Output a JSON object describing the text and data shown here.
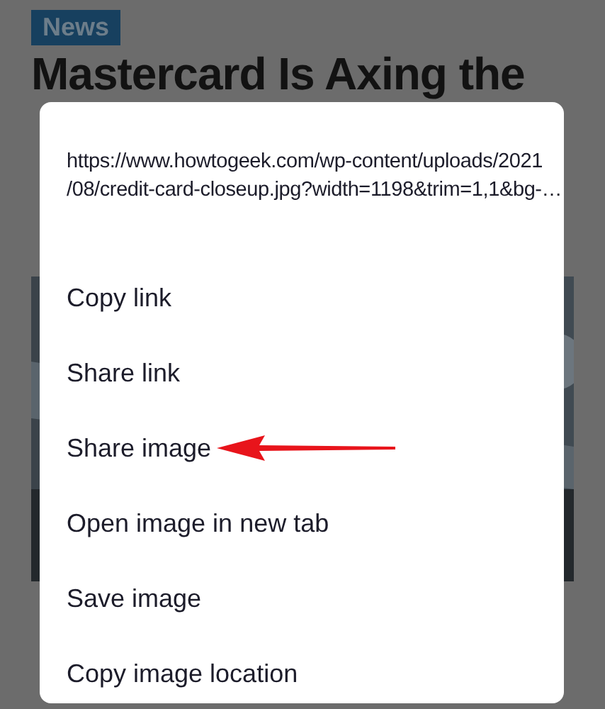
{
  "page": {
    "tag": "News",
    "headline": "Mastercard Is Axing the"
  },
  "dialog": {
    "url_lines": [
      "https://www.howtogeek.com/wp-content/uploads/2021",
      "/08/credit-card-closeup.jpg?width=1198&trim=1,1&bg-…"
    ],
    "items": [
      {
        "label": "Copy link",
        "highlighted": false
      },
      {
        "label": "Share link",
        "highlighted": false
      },
      {
        "label": "Share image",
        "highlighted": true
      },
      {
        "label": "Open image in new tab",
        "highlighted": false
      },
      {
        "label": "Save image",
        "highlighted": false
      },
      {
        "label": "Copy image location",
        "highlighted": false
      }
    ]
  }
}
